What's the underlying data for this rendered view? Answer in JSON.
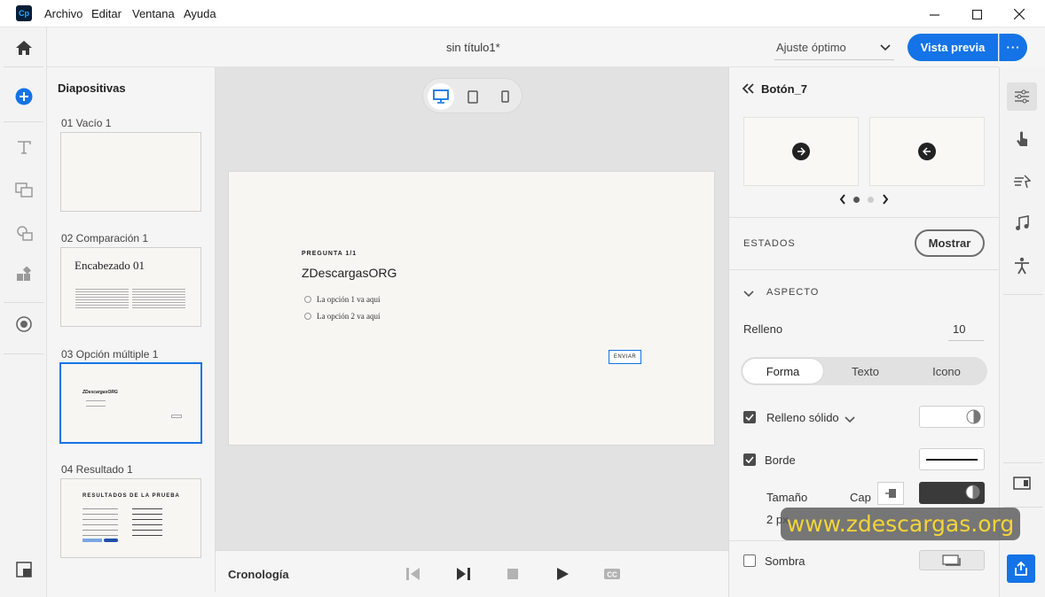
{
  "menubar": {
    "logo": "Cp",
    "items": [
      "Archivo",
      "Editar",
      "Ventana",
      "Ayuda"
    ]
  },
  "toolbar": {
    "doc_title": "sin título1*",
    "zoom": "Ajuste óptimo",
    "preview_label": "Vista previa",
    "more_label": "···"
  },
  "slides": {
    "title": "Diapositivas",
    "items": [
      {
        "label": "01 Vacío 1"
      },
      {
        "label": "02 Comparación 1",
        "heading": "Encabezado 01"
      },
      {
        "label": "03 Opción múltiple 1",
        "title": "ZDescargasORG"
      },
      {
        "label": "04 Resultado 1",
        "heading": "RESULTADOS DE LA PRUEBA"
      }
    ]
  },
  "canvas": {
    "question_label": "PREGUNTA 1/1",
    "question_title": "ZDescargasORG",
    "options": [
      "La opción 1 va aquí",
      "La opción 2 va aquí"
    ],
    "submit_label": "ENVIAR"
  },
  "timeline": {
    "label": "Cronología"
  },
  "properties": {
    "object_name": "Botón_7",
    "states_label": "ESTADOS",
    "show_label": "Mostrar",
    "aspect_label": "ASPECTO",
    "fill_label": "Relleno",
    "fill_value": "10",
    "tabs": [
      "Forma",
      "Texto",
      "Icono"
    ],
    "solid_fill_label": "Relleno sólido",
    "border_label": "Borde",
    "size_label": "Tamaño",
    "cap_label": "Cap",
    "size_value": "2 px",
    "shadow_label": "Sombra"
  },
  "watermark": "www.zdescargas.org",
  "colors": {
    "accent": "#1473e6",
    "watermark_text": "#f2d43a"
  }
}
